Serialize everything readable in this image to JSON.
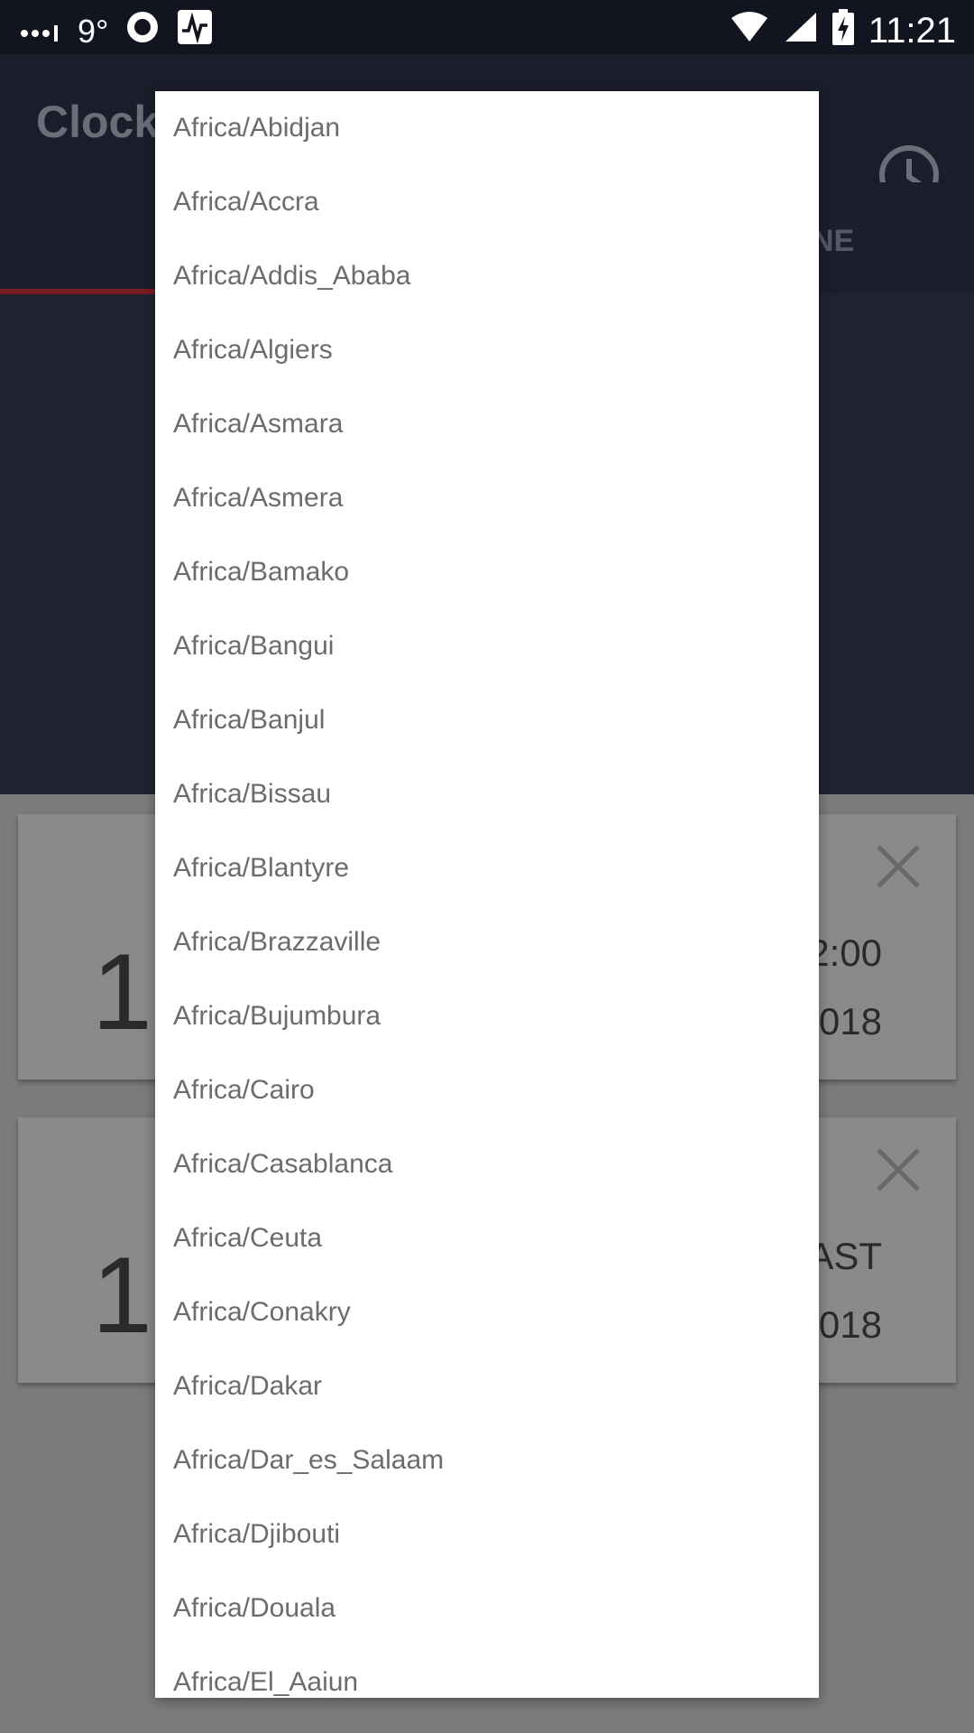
{
  "status_bar": {
    "temperature": "9°",
    "time": "11:21"
  },
  "app": {
    "title": "Clock",
    "tab_partial": "NE"
  },
  "cards": [
    {
      "big": "1",
      "time": "2:00",
      "date": "018"
    },
    {
      "big": "1",
      "time": "AST",
      "date": "018"
    }
  ],
  "timezone_options": [
    "Africa/Abidjan",
    "Africa/Accra",
    "Africa/Addis_Ababa",
    "Africa/Algiers",
    "Africa/Asmara",
    "Africa/Asmera",
    "Africa/Bamako",
    "Africa/Bangui",
    "Africa/Banjul",
    "Africa/Bissau",
    "Africa/Blantyre",
    "Africa/Brazzaville",
    "Africa/Bujumbura",
    "Africa/Cairo",
    "Africa/Casablanca",
    "Africa/Ceuta",
    "Africa/Conakry",
    "Africa/Dakar",
    "Africa/Dar_es_Salaam",
    "Africa/Djibouti",
    "Africa/Douala",
    "Africa/El_Aaiun"
  ]
}
